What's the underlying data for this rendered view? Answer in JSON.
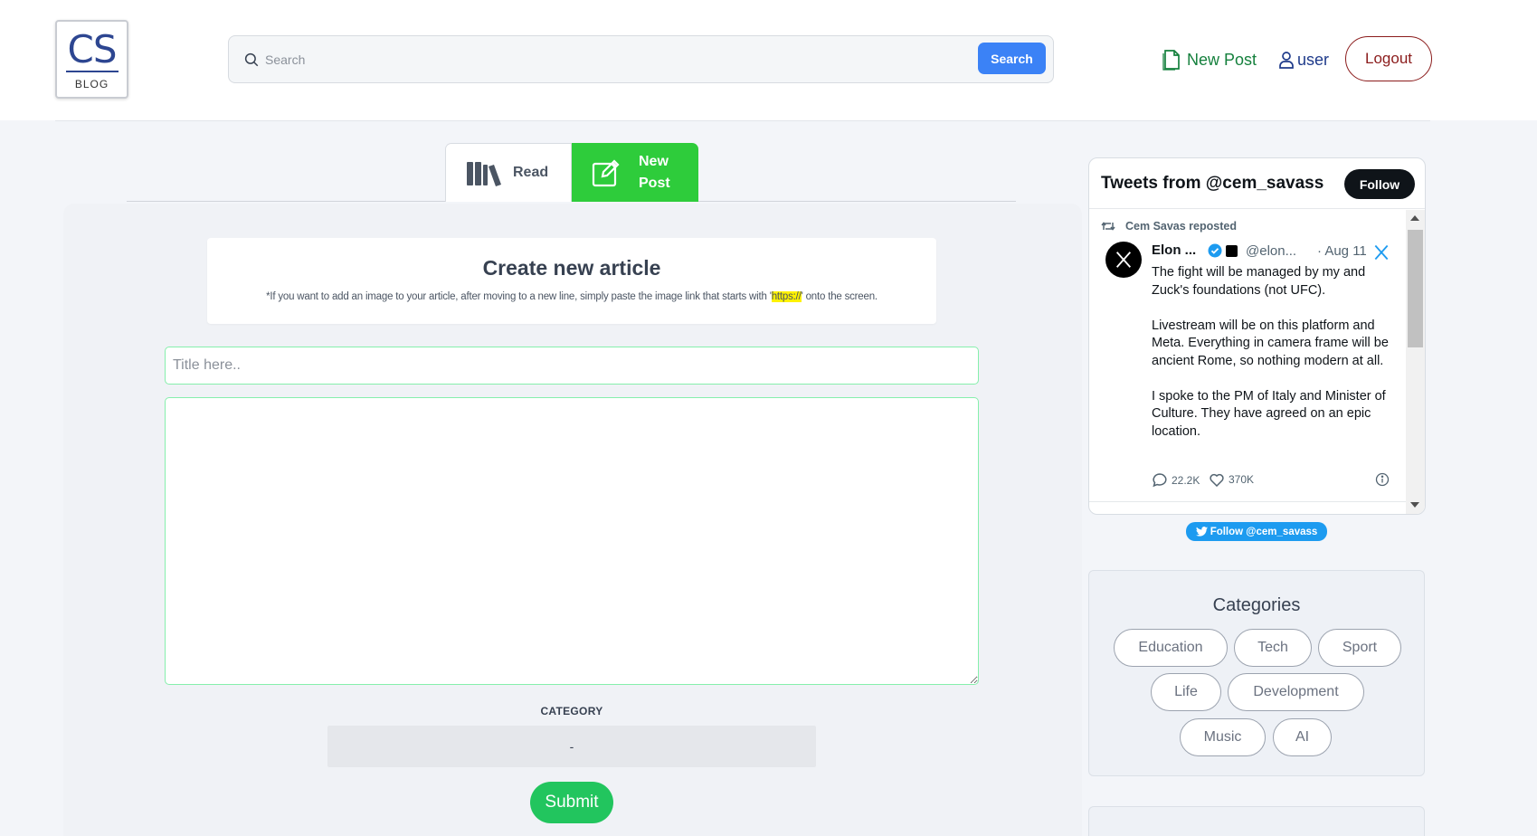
{
  "header": {
    "logo": {
      "main": "CS",
      "sub": "BLOG"
    },
    "search": {
      "placeholder": "Search",
      "button_label": "Search"
    },
    "nav": {
      "new_post_label": "New Post",
      "user_label": "user",
      "logout_label": "Logout"
    }
  },
  "tabs": [
    {
      "label": "Read",
      "active": false
    },
    {
      "label": "New Post",
      "active": true
    }
  ],
  "editor": {
    "title": "Create new article",
    "hint_prefix": "*If you want to add an image to your article, after moving to a new line, simply paste the image link that starts with '",
    "hint_highlight": "https://",
    "hint_suffix": "' onto the screen.",
    "title_placeholder": "Title here..",
    "body_value": "",
    "category_label": "CATEGORY",
    "category_value": "-",
    "submit_label": "Submit"
  },
  "tweets": {
    "header_title": "Tweets from @cem_savass",
    "follow_label": "Follow",
    "repost_text": "Cem Savas reposted",
    "author_name": "Elon ...",
    "author_handle": "@elon...",
    "date": "· Aug 11",
    "body": [
      "The fight will be managed by my and Zuck's foundations (not UFC).",
      "Livestream will be on this platform and Meta. Everything in camera frame will be ancient Rome, so nothing modern at all.",
      "I spoke to the PM of Italy and Minister of Culture. They have agreed on an epic location."
    ],
    "replies": "22.2K",
    "likes": "370K",
    "follow_pill_label": "Follow @cem_savass"
  },
  "categories": {
    "title": "Categories",
    "items": [
      "Education",
      "Tech",
      "Sport",
      "Life",
      "Development",
      "Music",
      "AI"
    ]
  },
  "colors": {
    "brand_navy": "#2d4691",
    "search_button": "#3b82f6",
    "active_tab": "#2ecc3b",
    "submit": "#22c55e",
    "logout": "#8b1c1c",
    "new_post_link": "#15803d",
    "twitter_blue": "#1d9bf0"
  }
}
